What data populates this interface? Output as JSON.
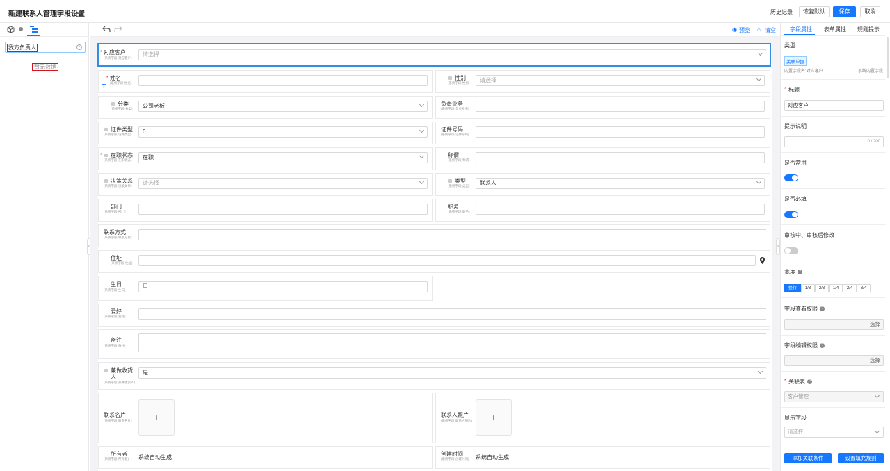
{
  "header": {
    "title": "新建联系人管理字段设置",
    "history": "历史记录",
    "restore_default": "恢复默认",
    "save": "保存",
    "cancel": "取消"
  },
  "left_panel": {
    "tabs": [
      "cube-icon",
      "circle-icon",
      "tree-icon"
    ],
    "search_value": "我方负责人",
    "empty_text": "暂无数据"
  },
  "toolbar": {
    "preview": "预览",
    "clear": "清空"
  },
  "fields": {
    "customer": {
      "label": "对应客户",
      "sub": "(系统字段-对应客户)",
      "placeholder": "请选择"
    },
    "name": {
      "label": "姓名",
      "sub": "(系统字段-姓名)",
      "value": ""
    },
    "gender": {
      "label": "性别",
      "sub": "(系统字段-性别)",
      "placeholder": "请选择"
    },
    "category": {
      "label": "分类",
      "sub": "(系统字段-分类)",
      "value": "公司老板"
    },
    "owner_biz": {
      "label": "负责业务",
      "sub": "(系统字段-负责业务)",
      "value": ""
    },
    "id_type": {
      "label": "证件类型",
      "sub": "(系统字段-证件类型)",
      "value": "0"
    },
    "id_no": {
      "label": "证件号码",
      "sub": "(系统字段-证件号码)",
      "value": ""
    },
    "status": {
      "label": "在职状态",
      "sub": "(系统字段-在职状态)",
      "value": "在职"
    },
    "title": {
      "label": "称谓",
      "sub": "(系统字段-称谓)",
      "value": ""
    },
    "decision": {
      "label": "决策关系",
      "sub": "(系统字段-决策关系)",
      "placeholder": "请选择"
    },
    "type": {
      "label": "类型",
      "sub": "(系统字段-类型)",
      "value": "联系人"
    },
    "dept": {
      "label": "部门",
      "sub": "(系统字段-部门)",
      "value": ""
    },
    "position": {
      "label": "职务",
      "sub": "(系统字段-职务)",
      "value": ""
    },
    "contact": {
      "label": "联系方式",
      "sub": "(系统字段-联系方式)",
      "value": ""
    },
    "address": {
      "label": "住址",
      "sub": "(系统字段-住址)",
      "value": ""
    },
    "birthday": {
      "label": "生日",
      "sub": "(系统字段-生日)",
      "value": ""
    },
    "hobby": {
      "label": "爱好",
      "sub": "(系统字段-爱好)",
      "value": ""
    },
    "remark": {
      "label": "备注",
      "sub": "(系统字段-备注)",
      "value": ""
    },
    "receiver": {
      "label": "兼做收货人",
      "sub": "(系统字段-兼做收货人)",
      "value": "是"
    },
    "card": {
      "label": "联系名片",
      "sub": "(系统字段-联系名片)",
      "plus": "+"
    },
    "photo": {
      "label": "联系人照片",
      "sub": "(系统字段-联系人照片)",
      "plus": "+"
    },
    "ownerf": {
      "label": "所有者",
      "sub": "(系统字段-所有者)",
      "value": "系统自动生成"
    },
    "created": {
      "label": "创建时间",
      "sub": "(系统字段-创建时间)",
      "value": "系统自动生成"
    }
  },
  "right_panel": {
    "tabs": [
      "字段属性",
      "表单属性",
      "规则提示"
    ],
    "type_label": "类型",
    "type_badge": "关联单据",
    "inner_name": "内置字段名:对应客户",
    "system_field": "系统内置字段",
    "title_label": "标题",
    "title_value": "对应客户",
    "hint_label": "提示说明",
    "hint_count": "0 / 200",
    "common_label": "是否常用",
    "required_label": "是否必填",
    "edit_label": "审核中、审核后修改",
    "width_label": "宽度",
    "width_options": [
      "整行",
      "1/3",
      "2/3",
      "1/4",
      "2/4",
      "3/4"
    ],
    "view_perm_label": "字段查看权限",
    "edit_perm_label": "字段编辑权限",
    "select_text": "选择",
    "related_label": "关联表",
    "related_value": "客户管理",
    "display_label": "显示字段",
    "display_placeholder": "请选择",
    "add_condition": "添加关联条件",
    "fill_rule": "设置填充规则"
  }
}
